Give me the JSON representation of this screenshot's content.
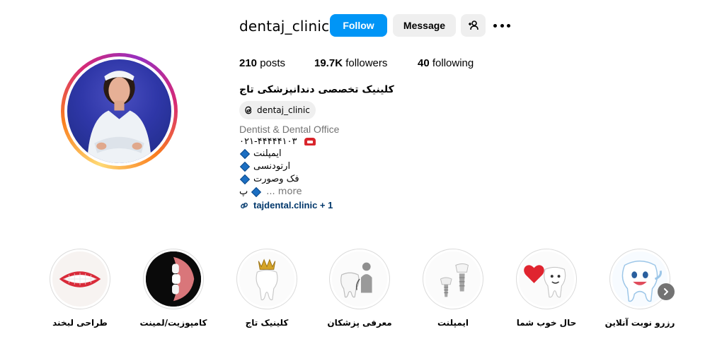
{
  "profile": {
    "username": "dentaj_clinic",
    "follow_label": "Follow",
    "message_label": "Message",
    "posts_count": "210",
    "posts_label": "posts",
    "followers_count": "19.7K",
    "followers_label": "followers",
    "following_count": "40",
    "following_label": "following",
    "full_name": "کلینیک تخصصی دندانپزشکی تاج",
    "threads_handle": "dentaj_clinic",
    "category": "Dentist & Dental Office",
    "bio_phone": "۰۲۱-۴۴۴۴۴۱۰۳",
    "bio_lines": [
      "ایمپلنت",
      "ارتودنسی",
      "فک وصورت",
      "پ"
    ],
    "more_label": "... more",
    "link_text": "tajdental.clinic + 1"
  },
  "highlights": [
    {
      "label": "طراحی لبخند",
      "icon": "smile-lips"
    },
    {
      "label": "کامپوزیت/لمینت",
      "icon": "laminate-teeth"
    },
    {
      "label": "کلینیک تاج",
      "icon": "tooth-crown"
    },
    {
      "label": "معرفی پزشکان",
      "icon": "tooth-doctor"
    },
    {
      "label": "ایمپلنت",
      "icon": "implant"
    },
    {
      "label": "حال خوب شما",
      "icon": "tooth-heart"
    },
    {
      "label": "رزرو نوبت آنلاین",
      "icon": "happy-tooth"
    }
  ],
  "colors": {
    "follow_button": "#0095f6",
    "secondary_button": "#efefef",
    "link": "#00376b",
    "muted_text": "#737373"
  }
}
